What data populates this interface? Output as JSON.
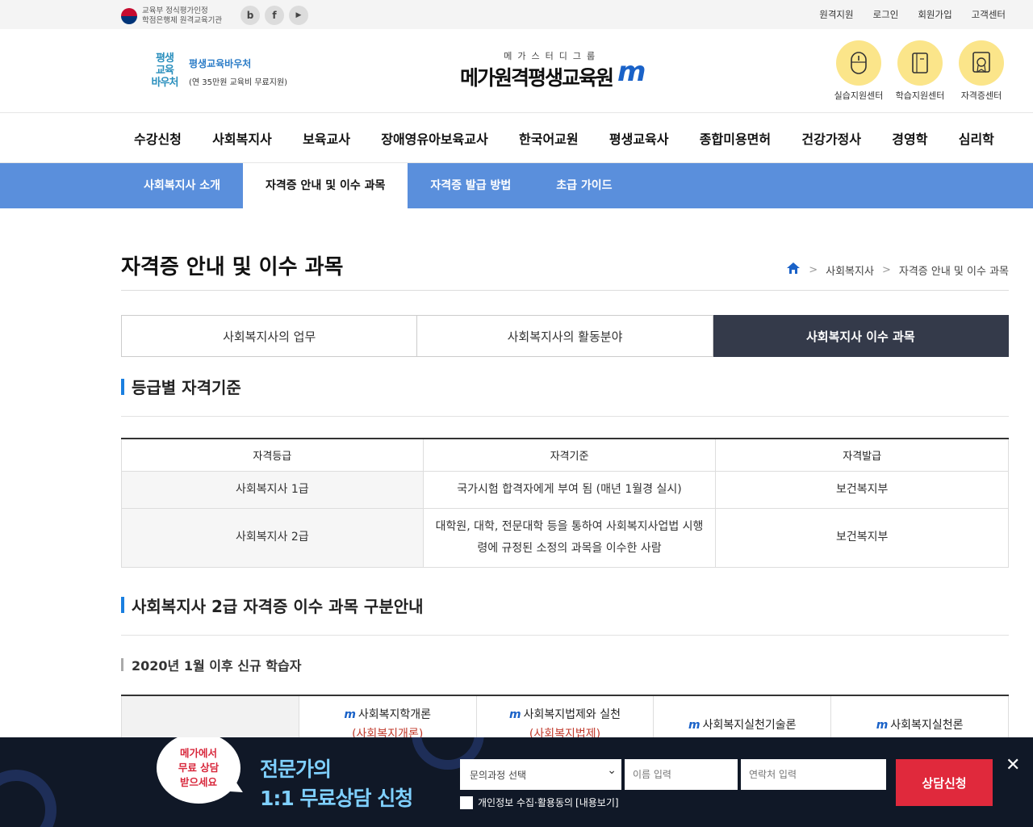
{
  "topbar": {
    "gov_line1": "교육부 정식평가인정",
    "gov_line2": "학점은행제 원격교육기관",
    "sns": [
      "b",
      "f",
      "▶"
    ],
    "links": [
      "원격지원",
      "로그인",
      "회원가입",
      "고객센터"
    ]
  },
  "header": {
    "voucher": {
      "logo": "평생교육바우처",
      "title": "평생교육바우처",
      "sub": "(연 35만원 교육비 무료지원)"
    },
    "brand": {
      "group": "메가스터디그룹",
      "name": "메가원격평생교육원",
      "mark": "m"
    },
    "centers": [
      "실습지원센터",
      "학습지원센터",
      "자격증센터"
    ]
  },
  "gnb": [
    "수강신청",
    "사회복지사",
    "보육교사",
    "장애영유아보육교사",
    "한국어교원",
    "평생교육사",
    "종합미용면허",
    "건강가정사",
    "경영학",
    "심리학"
  ],
  "subnav": [
    "사회복지사 소개",
    "자격증 안내 및 이수 과목",
    "자격증 발급 방법",
    "초급 가이드"
  ],
  "page": {
    "title": "자격증 안내 및 이수 과목",
    "breadcrumb": [
      "사회복지사",
      "자격증 안내 및 이수 과목"
    ]
  },
  "tabs": [
    "사회복지사의 업무",
    "사회복지사의 활동분야",
    "사회복지사 이수 과목"
  ],
  "section1": {
    "title": "등급별 자격기준",
    "headers": [
      "자격등급",
      "자격기준",
      "자격발급"
    ],
    "rows": [
      [
        "사회복지사 1급",
        "국가시험 합격자에게 부여 됨 (매년 1월경 실시)",
        "보건복지부"
      ],
      [
        "사회복지사 2급",
        "대학원, 대학, 전문대학 등을 통하여 사회복지사업법 시행령에 규정된 소정의 과목을 이수한 사람",
        "보건복지부"
      ]
    ]
  },
  "section2": {
    "title": "사회복지사 2급 자격증 이수 과목 구분안내",
    "subtitle": "2020년 1월 이후 신규 학습자",
    "courses": [
      {
        "name": "사회복지학개론",
        "alt": "(사회복지개론)"
      },
      {
        "name": "사회복지법제와 실천",
        "alt": "(사회복지법제)"
      },
      {
        "name": "사회복지실천기술론",
        "alt": ""
      },
      {
        "name": "사회복지실천론",
        "alt": ""
      }
    ]
  },
  "banner": {
    "bubble": "메가에서\n무료 상담\n받으세요",
    "title1": "전문가의",
    "title2": "1:1 무료상담 신청",
    "select": "문의과정 선택",
    "name_ph": "이름 입력",
    "phone_ph": "연락처 입력",
    "agree": "개인정보 수집·활용동의",
    "agree_link": "[내용보기]",
    "submit": "상담신청",
    "close": "✕"
  },
  "colors": {
    "accent": "#5a8fdc",
    "tab_active": "#343a4a",
    "submit": "#e0293c",
    "banner_bg": "#101827"
  }
}
